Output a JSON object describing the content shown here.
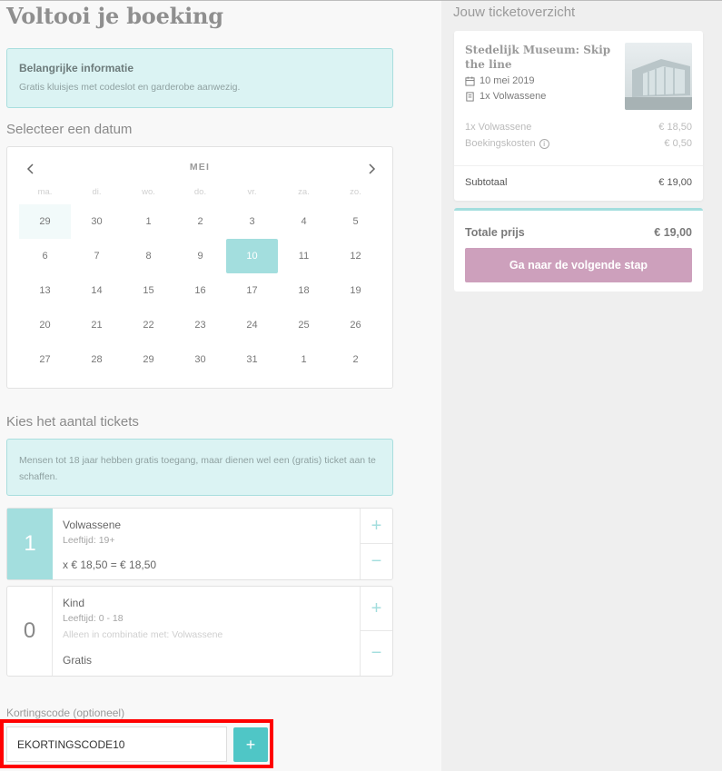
{
  "page": {
    "title": "Voltooi je boeking"
  },
  "info": {
    "title": "Belangrijke informatie",
    "text": "Gratis kluisjes met codeslot en garderobe aanwezig."
  },
  "date_section": {
    "heading": "Selecteer een datum"
  },
  "calendar": {
    "month": "MEI",
    "weekdays": [
      "ma.",
      "di.",
      "wo.",
      "do.",
      "vr.",
      "za.",
      "zo."
    ],
    "weeks": [
      [
        "29",
        "30",
        "1",
        "2",
        "3",
        "4",
        "5"
      ],
      [
        "6",
        "7",
        "8",
        "9",
        "10",
        "11",
        "12"
      ],
      [
        "13",
        "14",
        "15",
        "16",
        "17",
        "18",
        "19"
      ],
      [
        "20",
        "21",
        "22",
        "23",
        "24",
        "25",
        "26"
      ],
      [
        "27",
        "28",
        "29",
        "30",
        "31",
        "1",
        "2"
      ]
    ],
    "selected": "10",
    "colors": {
      "selected": "#a3dede",
      "previous_month": "#f2fafa"
    }
  },
  "tickets_section": {
    "heading": "Kies het aantal tickets",
    "notice": "Mensen tot 18 jaar hebben gratis toegang, maar dienen wel een (gratis) ticket aan te schaffen.",
    "items": [
      {
        "qty": "1",
        "name": "Volwassene",
        "age": "Leeftijd: 19+",
        "combo": "",
        "price": "x € 18,50 = € 18,50",
        "plus": "+",
        "minus": "−"
      },
      {
        "qty": "0",
        "name": "Kind",
        "age": "Leeftijd: 0 - 18",
        "combo": "Alleen in combinatie met: Volwassene",
        "price": "Gratis",
        "plus": "+",
        "minus": "−"
      }
    ]
  },
  "discount": {
    "label": "Kortingscode (optioneel)",
    "value": "EKORTINGSCODE10",
    "add_label": "+"
  },
  "overview": {
    "heading": "Jouw ticketoverzicht",
    "product": "Stedelijk Museum: Skip the line",
    "date": "10 mei 2019",
    "tickets": "1x Volwassene",
    "lines": [
      {
        "label": "1x Volwassene",
        "amount": "€ 18,50"
      },
      {
        "label": "Boekingskosten",
        "amount": "€ 0,50",
        "info": "i"
      }
    ],
    "subtotal_label": "Subtotaal",
    "subtotal_amount": "€ 19,00",
    "total_label": "Totale prijs",
    "total_amount": "€ 19,00",
    "next_button": "Ga naar de volgende stap"
  },
  "icons": {
    "calendar": "calendar-icon",
    "ticket": "ticket-icon",
    "prev": "chevron-left-icon",
    "next": "chevron-right-icon",
    "info": "info-icon"
  },
  "colors": {
    "accent": "#4fc6c6",
    "cta": "#cda0bc",
    "highlight": "#ff0000"
  }
}
